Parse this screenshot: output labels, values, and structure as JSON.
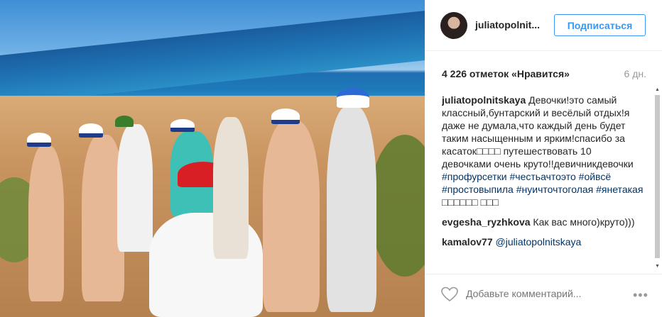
{
  "header": {
    "username": "juliatopolnit...",
    "follow_label": "Подписаться"
  },
  "stats": {
    "likes": "4 226 отметок «Нравится»",
    "time_ago": "6 дн."
  },
  "caption": {
    "user": "juliatopolnitskaya",
    "text_before": " Девочки!это самый классный,бунтарский и весёлый отдых!я даже не думала,что каждый день будет таким насыщенным и ярким!спасибо за касаток□□□□ путешествовать 10 девочками очень круто!!девичникдевочки ",
    "hashtags": [
      "#профурсетки",
      "#честьачтоэто",
      "#ойвсё",
      "#простовыпила",
      "#нуичточтоголая",
      "#янетакая"
    ],
    "text_after": " □□□□□□ □□□"
  },
  "comments": [
    {
      "user": "evgesha_ryzhkova",
      "text": " Как вас много)круто)))"
    },
    {
      "user": "kamalov77",
      "text": " ",
      "mention": "@juliatopolnitskaya"
    }
  ],
  "comment_box": {
    "placeholder": "Добавьте комментарий..."
  },
  "icons": {
    "like": "heart-icon",
    "more": "more-options-icon",
    "scroll_up": "scroll-up-icon",
    "scroll_down": "scroll-down-icon"
  },
  "colors": {
    "accent": "#3897f0",
    "hashtag": "#003569",
    "muted": "#999999"
  }
}
